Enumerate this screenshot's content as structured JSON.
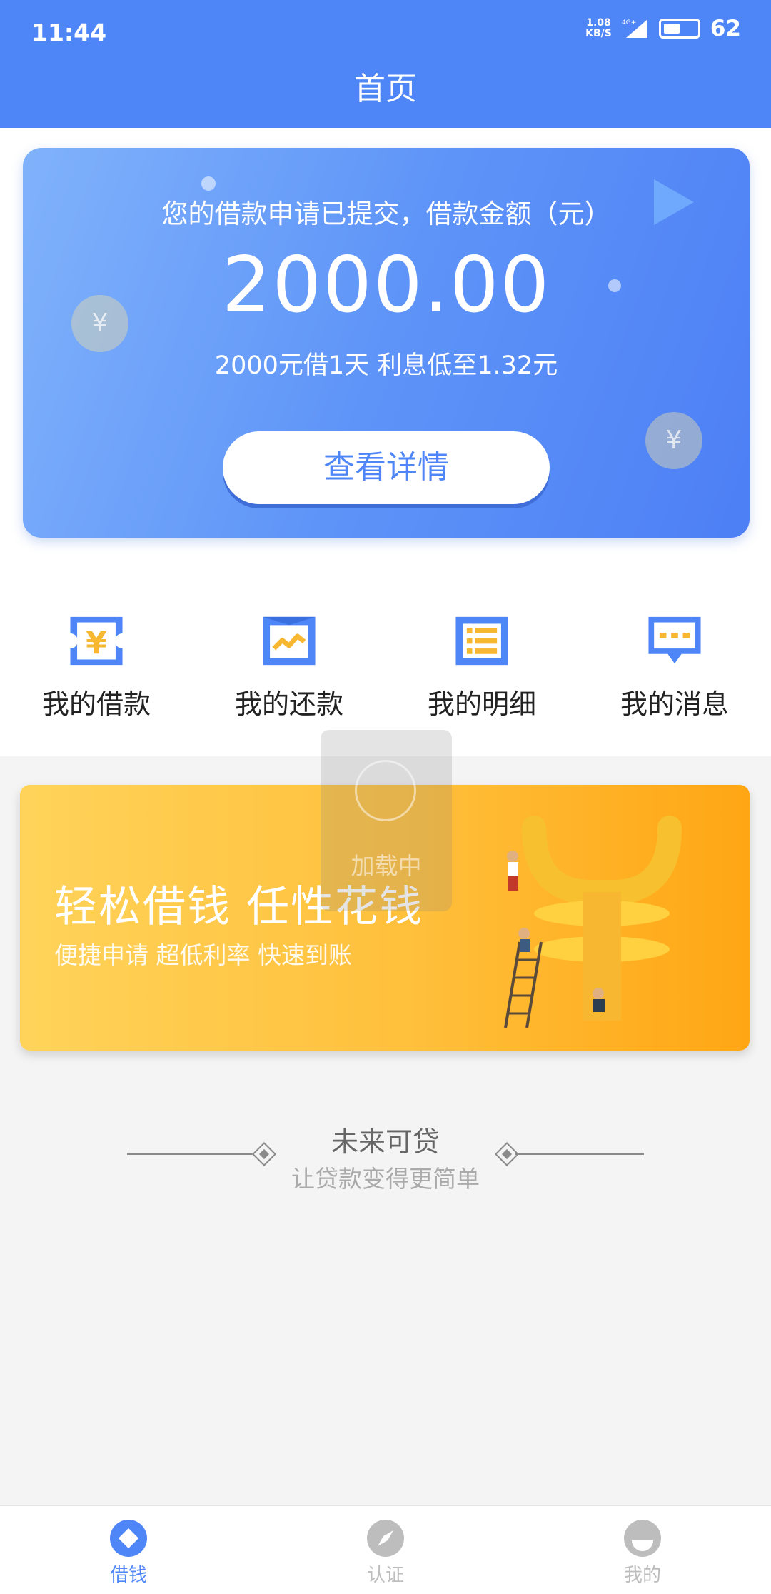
{
  "status_bar": {
    "time": "11:44",
    "speed_value": "1.08",
    "speed_unit": "KB/S",
    "network": "4G+",
    "battery": "62"
  },
  "header": {
    "title": "首页"
  },
  "loan_card": {
    "caption": "您的借款申请已提交，借款金额（元）",
    "amount": "2000.00",
    "subtitle": "2000元借1天 利息低至1.32元",
    "button_label": "查看详情"
  },
  "menu": {
    "items": [
      {
        "label": "我的借款",
        "icon": "ticket-yen-icon"
      },
      {
        "label": "我的还款",
        "icon": "chart-frame-icon"
      },
      {
        "label": "我的明细",
        "icon": "list-icon"
      },
      {
        "label": "我的消息",
        "icon": "message-icon"
      }
    ]
  },
  "loading": {
    "text": "加载中"
  },
  "banner": {
    "title": "轻松借钱  任性花钱",
    "subtitle": "便捷申请 超低利率 快速到账"
  },
  "brand": {
    "name": "未来可贷",
    "slogan": "让贷款变得更简单"
  },
  "tabbar": {
    "active_color": "#4f86f7",
    "inactive_color": "#bdbdbd",
    "tabs": [
      {
        "label": "借钱",
        "icon": "diamond-icon",
        "active": true
      },
      {
        "label": "认证",
        "icon": "compass-icon",
        "active": false
      },
      {
        "label": "我的",
        "icon": "profile-icon",
        "active": false
      }
    ]
  }
}
